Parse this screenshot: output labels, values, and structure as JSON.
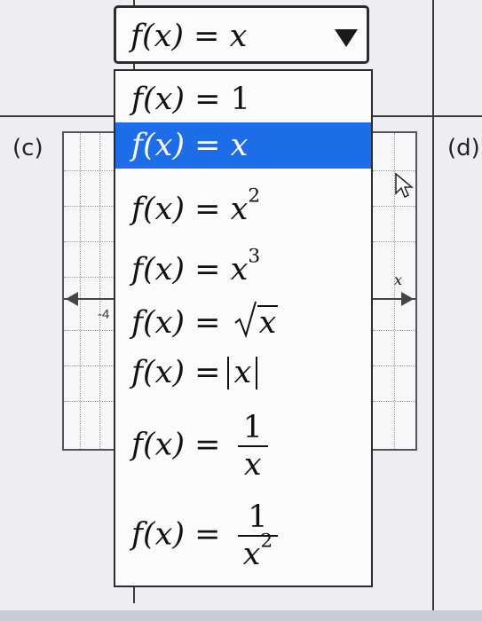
{
  "labels": {
    "part_c": "(c)",
    "part_d": "(d)"
  },
  "graph_left": {
    "tick_label": "-4"
  },
  "graph_right": {
    "axis_label": "x"
  },
  "select": {
    "selected_lhs": "f(x) =",
    "selected_rhs": "x"
  },
  "dropdown": {
    "options": [
      {
        "lhs": "f(x) =",
        "rhs": "1"
      },
      {
        "lhs": "f(x) =",
        "rhs": "x"
      },
      {
        "lhs": "f(x) =",
        "base": "x",
        "exp": "2"
      },
      {
        "lhs": "f(x) =",
        "base": "x",
        "exp": "3"
      },
      {
        "lhs": "f(x) =",
        "radicand": "x"
      },
      {
        "lhs": "f(x) =",
        "abs": "x"
      },
      {
        "lhs": "f(x) =",
        "num": "1",
        "den": "x"
      },
      {
        "lhs": "f(x) =",
        "num": "1",
        "den_base": "x",
        "den_exp": "2"
      }
    ]
  },
  "colors": {
    "highlight": "#1d6ce8",
    "page": "#eeeef2"
  }
}
